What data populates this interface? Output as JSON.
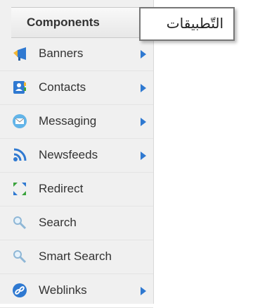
{
  "menu": {
    "title": "Components",
    "items": [
      {
        "label": "Banners",
        "icon": "banners-icon",
        "has_submenu": true
      },
      {
        "label": "Contacts",
        "icon": "contacts-icon",
        "has_submenu": true
      },
      {
        "label": "Messaging",
        "icon": "messaging-icon",
        "has_submenu": true
      },
      {
        "label": "Newsfeeds",
        "icon": "newsfeeds-icon",
        "has_submenu": true
      },
      {
        "label": "Redirect",
        "icon": "redirect-icon",
        "has_submenu": false
      },
      {
        "label": "Search",
        "icon": "search-icon",
        "has_submenu": false
      },
      {
        "label": "Smart Search",
        "icon": "smart-search-icon",
        "has_submenu": false
      },
      {
        "label": "Weblinks",
        "icon": "weblinks-icon",
        "has_submenu": true
      }
    ],
    "arrow_color": "#2f79d1"
  },
  "tooltip": {
    "text": "التّطبيقات"
  }
}
